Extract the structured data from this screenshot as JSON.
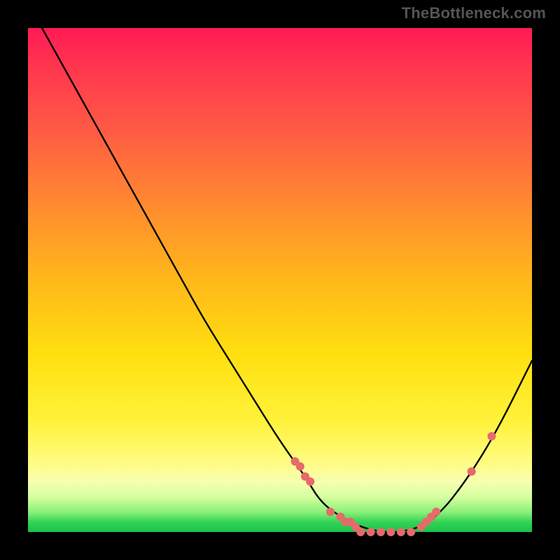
{
  "watermark": "TheBottleneck.com",
  "colors": {
    "curve_stroke": "#000000",
    "point_fill": "#e66a6a",
    "gradient_top": "#ff1a55",
    "gradient_mid": "#ffe010",
    "gradient_bottom": "#18c24a",
    "page_bg": "#000000"
  },
  "chart_data": {
    "type": "line",
    "title": "",
    "xlabel": "",
    "ylabel": "",
    "xlim": [
      0,
      100
    ],
    "ylim": [
      0,
      100
    ],
    "grid": false,
    "legend": false,
    "series": [
      {
        "name": "bottleneck-curve",
        "x": [
          0,
          5,
          10,
          15,
          20,
          25,
          30,
          35,
          40,
          45,
          50,
          55,
          58,
          62,
          66,
          70,
          74,
          78,
          82,
          86,
          90,
          94,
          98,
          100
        ],
        "y": [
          105,
          96,
          87,
          78,
          69,
          60,
          51,
          42,
          34,
          26,
          18,
          11,
          6,
          3,
          1,
          0,
          0,
          1,
          4,
          9,
          15,
          22,
          30,
          34
        ]
      }
    ],
    "points": {
      "name": "highlight-dots",
      "x": [
        53,
        54,
        55,
        56,
        60,
        62,
        63,
        64,
        65,
        66,
        68,
        70,
        72,
        74,
        76,
        78,
        79,
        80,
        81,
        88,
        92
      ],
      "y": [
        14,
        13,
        11,
        10,
        4,
        3,
        2,
        2,
        1,
        0,
        0,
        0,
        0,
        0,
        0,
        1,
        2,
        3,
        4,
        12,
        19
      ]
    }
  }
}
